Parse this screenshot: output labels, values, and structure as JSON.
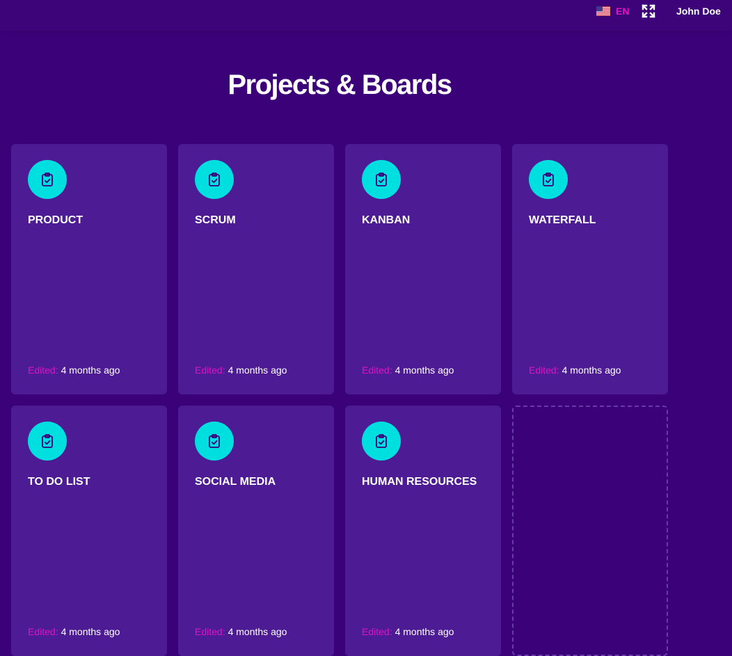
{
  "header": {
    "language_code": "EN",
    "language_flag_icon": "us-flag-icon",
    "fullscreen_icon": "fullscreen-icon",
    "user_name": "John Doe"
  },
  "page": {
    "title": "Projects & Boards"
  },
  "colors": {
    "background": "#3b0179",
    "card": "#4d1b94",
    "icon_circle": "#00dfe0",
    "accent": "#e212c5"
  },
  "boards": [
    {
      "title": "PRODUCT",
      "edited_label": "Edited:",
      "edited_value": "4 months ago",
      "icon": "clipboard-check-icon"
    },
    {
      "title": "SCRUM",
      "edited_label": "Edited:",
      "edited_value": "4 months ago",
      "icon": "clipboard-check-icon"
    },
    {
      "title": "KANBAN",
      "edited_label": "Edited:",
      "edited_value": "4 months ago",
      "icon": "clipboard-check-icon"
    },
    {
      "title": "WATERFALL",
      "edited_label": "Edited:",
      "edited_value": "4 months ago",
      "icon": "clipboard-check-icon"
    },
    {
      "title": "TO DO LIST",
      "edited_label": "Edited:",
      "edited_value": "4 months ago",
      "icon": "clipboard-check-icon"
    },
    {
      "title": "SOCIAL MEDIA",
      "edited_label": "Edited:",
      "edited_value": "4 months ago",
      "icon": "clipboard-check-icon"
    },
    {
      "title": "HUMAN RESOURCES",
      "edited_label": "Edited:",
      "edited_value": "4 months ago",
      "icon": "clipboard-check-icon"
    }
  ]
}
